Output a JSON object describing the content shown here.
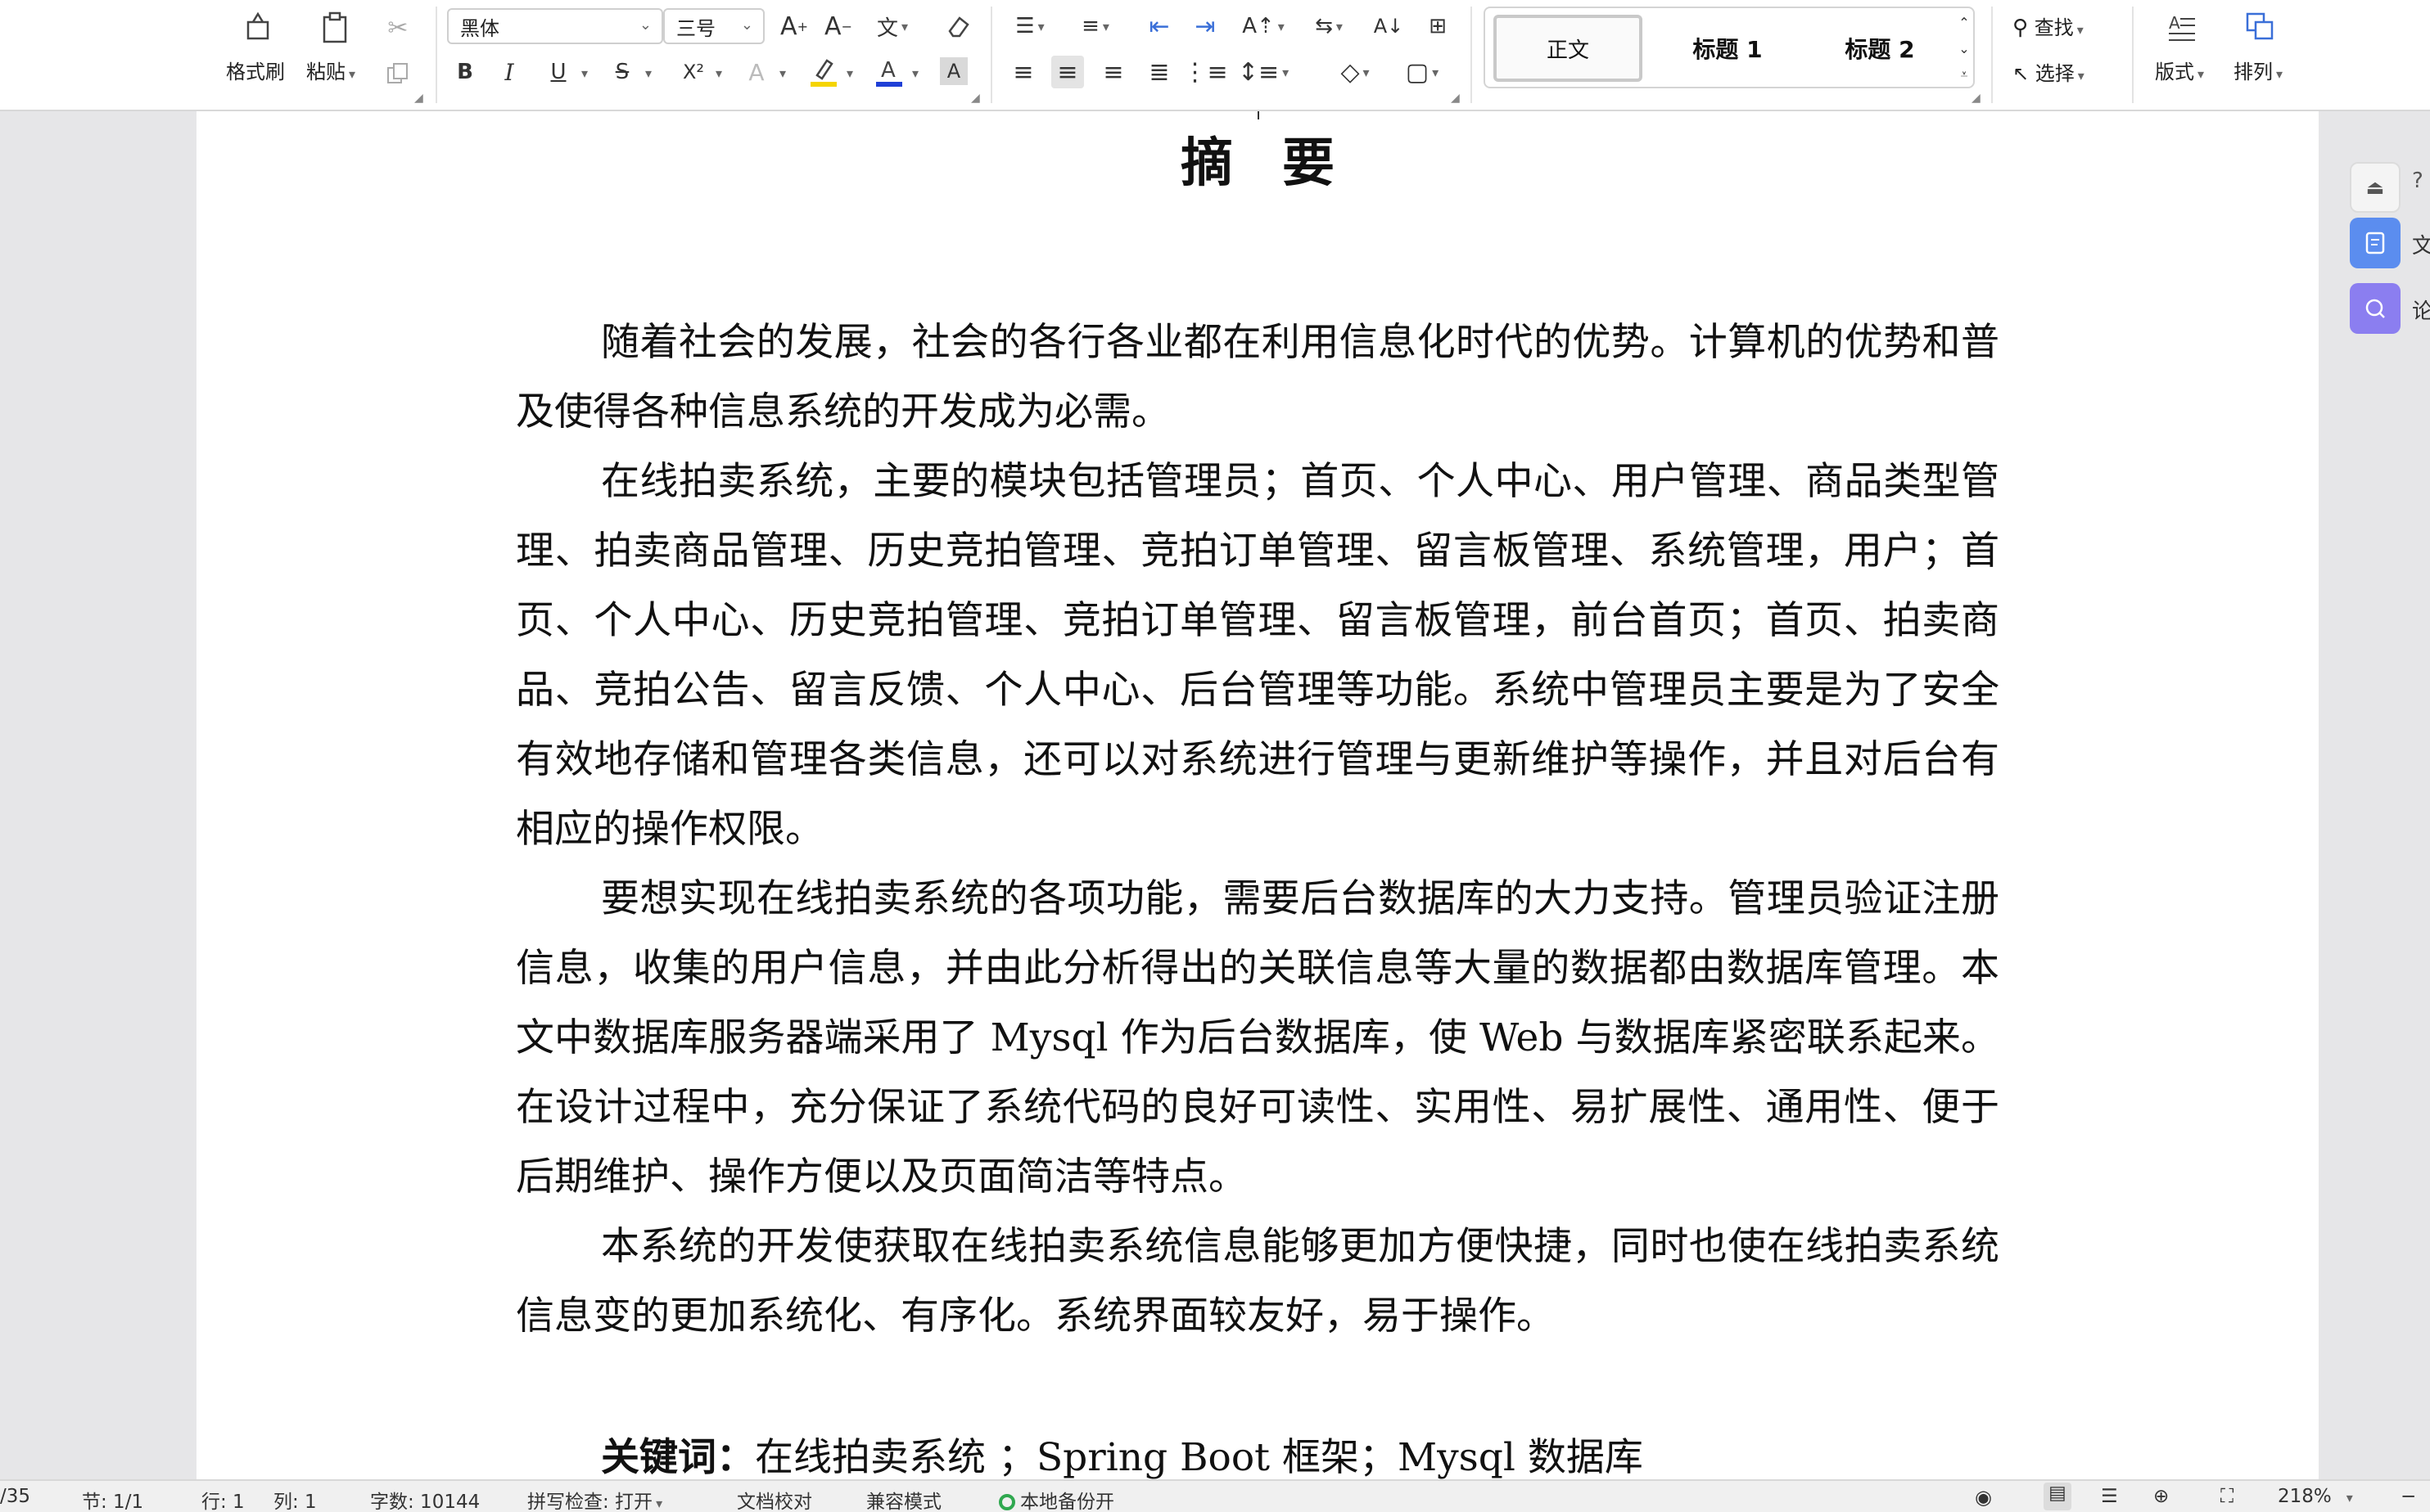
{
  "toolbar": {
    "format_painter": "格式刷",
    "paste": "粘贴",
    "font_family": "黑体",
    "font_size": "三号",
    "style_normal": "正文",
    "style_h1": "标题 1",
    "style_h2": "标题 2",
    "find": "查找",
    "select": "选择",
    "layout": "版式",
    "arrange": "排列",
    "icons": {
      "bold": "B",
      "italic": "I",
      "underline": "U",
      "strike": "S",
      "superscript": "X²",
      "shading": "A"
    }
  },
  "document": {
    "title": "摘要",
    "paragraphs": [
      "随着社会的发展，社会的各行各业都在利用信息化时代的优势。计算机的优势和普及使得各种信息系统的开发成为必需。",
      "在线拍卖系统，主要的模块包括管理员；首页、个人中心、用户管理、商品类型管理、拍卖商品管理、历史竞拍管理、竞拍订单管理、留言板管理、系统管理，用户；首页、个人中心、历史竞拍管理、竞拍订单管理、留言板管理，前台首页；首页、拍卖商品、竞拍公告、留言反馈、个人中心、后台管理等功能。系统中管理员主要是为了安全有效地存储和管理各类信息，还可以对系统进行管理与更新维护等操作，并且对后台有相应的操作权限。",
      "要想实现在线拍卖系统的各项功能，需要后台数据库的大力支持。管理员验证注册信息，收集的用户信息，并由此分析得出的关联信息等大量的数据都由数据库管理。本文中数据库服务器端采用了 Mysql 作为后台数据库，使 Web 与数据库紧密联系起来。在设计过程中，充分保证了系统代码的良好可读性、实用性、易扩展性、通用性、便于后期维护、操作方便以及页面简洁等特点。",
      "本系统的开发使获取在线拍卖系统信息能够更加方便快捷，同时也使在线拍卖系统信息变的更加系统化、有序化。系统界面较友好，易于操作。"
    ],
    "keywords_label": "关键词：",
    "keywords_text": "在线拍卖系统 ；Spring Boot 框架；Mysql 数据库"
  },
  "side_panel": {
    "item1": "文",
    "item2": "论"
  },
  "status": {
    "page": "/35",
    "section": "节: 1/1",
    "row": "行: 1",
    "col": "列: 1",
    "word_count": "字数: 10144",
    "spell_check": "拼写检查: 打开",
    "proofread": "文档校对",
    "compat_mode": "兼容模式",
    "backup": "本地备份开",
    "zoom": "218%"
  },
  "colors": {
    "highlight": "#f5d400",
    "font_color": "#1f3fd6",
    "side_blue": "#5b8def",
    "side_purple": "#8b7ef0",
    "backup_green": "#2fa84f"
  }
}
